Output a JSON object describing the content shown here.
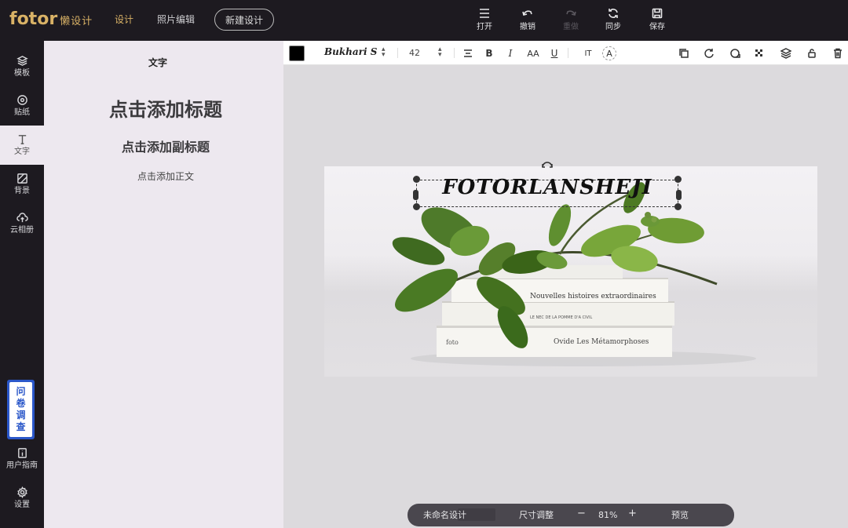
{
  "app": {
    "logo_text": "fotor",
    "logo_cn": "懒设计",
    "accent_color": "#d9b266"
  },
  "topnav": {
    "design_label": "设计",
    "photo_edit_label": "照片编辑",
    "new_design_label": "新建设计"
  },
  "toolbar": {
    "open_label": "打开",
    "undo_label": "撤销",
    "redo_label": "重做",
    "sync_label": "同步",
    "save_label": "保存"
  },
  "sidebar": {
    "items": [
      {
        "label": "模板",
        "icon": "layers-icon"
      },
      {
        "label": "贴纸",
        "icon": "sticker-icon"
      },
      {
        "label": "文字",
        "icon": "text-icon"
      },
      {
        "label": "背景",
        "icon": "background-icon"
      },
      {
        "label": "云相册",
        "icon": "cloud-upload-icon"
      }
    ],
    "survey_label": "问卷调查",
    "guide_label": "用户指南",
    "settings_label": "设置"
  },
  "text_panel": {
    "title": "文字",
    "add_title": "点击添加标题",
    "add_subtitle": "点击添加副标题",
    "add_body": "点击添加正文"
  },
  "text_toolbar": {
    "text_color": "#000000",
    "font_name": "Bukhari S",
    "font_size": "42"
  },
  "canvas": {
    "headline": "FOTORLANSHEJI",
    "book_titles": [
      "Nouvelles histoires extraordinaires",
      "LE NEC DE LA POMME D'A CIVIL",
      "Ovide   Les Métamorphoses"
    ]
  },
  "bottom_bar": {
    "design_name": "未命名设计",
    "resize_label": "尺寸调整",
    "zoom_out": "−",
    "zoom_level": "81%",
    "zoom_in": "+",
    "preview_label": "预览"
  }
}
